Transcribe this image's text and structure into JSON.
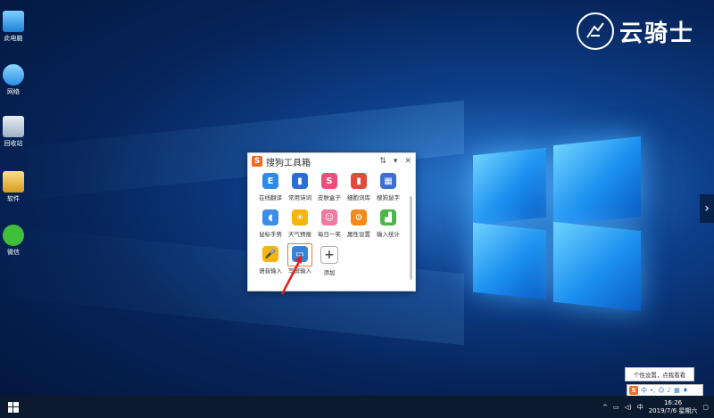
{
  "watermark": {
    "text": "云骑士"
  },
  "desktop_icons": [
    {
      "label": "此电脑",
      "icon": "computer-icon"
    },
    {
      "label": "网络",
      "icon": "network-icon"
    },
    {
      "label": "回收站",
      "icon": "recycle-bin-icon"
    },
    {
      "label": "软件",
      "icon": "folder-icon"
    },
    {
      "label": "微信",
      "icon": "wechat-icon"
    }
  ],
  "toolbox": {
    "title": "搜狗工具箱",
    "logo": "S",
    "tools": [
      {
        "label": "在线翻译",
        "icon": "translate-icon",
        "color": "#2b8de8",
        "glyph": "E"
      },
      {
        "label": "常用诗词",
        "icon": "book-icon",
        "color": "#2b6fd6",
        "glyph": "▮"
      },
      {
        "label": "皮肤盒子",
        "icon": "skin-shirt-icon",
        "color": "#ee4f7a",
        "glyph": "S"
      },
      {
        "label": "细胞词库",
        "icon": "dictionary-icon",
        "color": "#e14b3b",
        "glyph": "▮"
      },
      {
        "label": "搜狗鼠字",
        "icon": "calendar-icon",
        "color": "#3b6fd0",
        "glyph": "▦"
      },
      {
        "label": "鼠标手势",
        "icon": "mouse-icon",
        "color": "#3b8de8",
        "glyph": "◖"
      },
      {
        "label": "天气预报",
        "icon": "sun-icon",
        "color": "#f5b40e",
        "glyph": "☀"
      },
      {
        "label": "每日一笑",
        "icon": "smile-icon",
        "color": "#f07aa0",
        "glyph": "☺"
      },
      {
        "label": "属性设置",
        "icon": "gear-icon",
        "color": "#f28a1e",
        "glyph": "⚙"
      },
      {
        "label": "输入统计",
        "icon": "bar-chart-icon",
        "color": "#4bb54a",
        "glyph": "▟"
      },
      {
        "label": "语音输入",
        "icon": "microphone-icon",
        "color": "#f5b40e",
        "glyph": "🎤"
      },
      {
        "label": "写屏输入",
        "icon": "screen-input-icon",
        "color": "#3b82d6",
        "glyph": "▭",
        "selected": true
      },
      {
        "label": "添加",
        "icon": "add-icon",
        "color": "#ffffff",
        "glyph": "+"
      }
    ]
  },
  "tray": {
    "tooltip": "个性设置，点我看看",
    "ime_label": "中",
    "time": "16:26",
    "date": "2019/7/6 星期六"
  }
}
